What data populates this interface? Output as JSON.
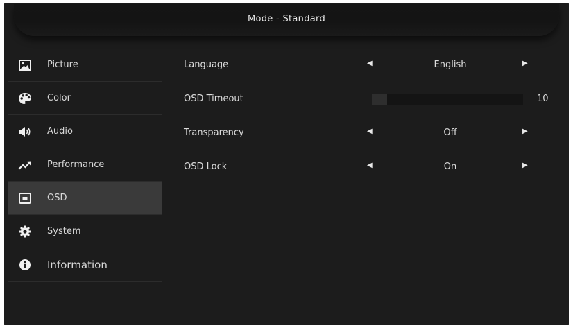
{
  "header": {
    "title": "Mode - Standard"
  },
  "sidebar": {
    "items": [
      {
        "label": "Picture",
        "icon": "picture-icon"
      },
      {
        "label": "Color",
        "icon": "palette-icon"
      },
      {
        "label": "Audio",
        "icon": "speaker-icon"
      },
      {
        "label": "Performance",
        "icon": "trend-up-icon"
      },
      {
        "label": "OSD",
        "icon": "osd-window-icon",
        "active": true
      },
      {
        "label": "System",
        "icon": "gear-icon"
      },
      {
        "label": "Information",
        "icon": "info-icon"
      }
    ]
  },
  "settings": {
    "language": {
      "label": "Language",
      "value": "English"
    },
    "osd_timeout": {
      "label": "OSD Timeout",
      "value": "10",
      "level": 0.1
    },
    "transparency": {
      "label": "Transparency",
      "value": "Off"
    },
    "osd_lock": {
      "label": "OSD Lock",
      "value": "On"
    }
  },
  "icons": {
    "left_arrow": "◀",
    "right_arrow": "▶"
  },
  "colors": {
    "background": "#1c1c1c",
    "active_item": "#3a3a3a",
    "text": "#dcdcdc"
  }
}
